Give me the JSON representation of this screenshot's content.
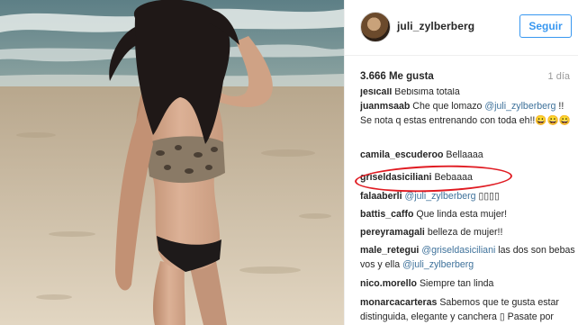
{
  "post": {
    "username": "juli_zylberberg",
    "follow_label": "Seguir",
    "likes": "3.666 Me gusta",
    "time": "1 día"
  },
  "comments": [
    {
      "user": "jesicall",
      "parts": [
        {
          "t": "Bebisima totala",
          "m": false
        }
      ]
    },
    {
      "user": "juanmsaab",
      "parts": [
        {
          "t": "Che que lomazo ",
          "m": false
        },
        {
          "t": "@juli_zylberberg",
          "m": true
        },
        {
          "t": " !! Se nota q estas entrenando con toda eh!!😀😀😀",
          "m": false
        }
      ]
    },
    {
      "user": "camila_escuderoo",
      "parts": [
        {
          "t": "Bellaaaa",
          "m": false
        }
      ]
    },
    {
      "user": "griseldasiciliani",
      "parts": [
        {
          "t": "Bebaaaa",
          "m": false
        }
      ]
    },
    {
      "user": "falaaberli",
      "parts": [
        {
          "t": "@juli_zylberberg",
          "m": true
        },
        {
          "t": " ▯▯▯▯",
          "m": false
        }
      ]
    },
    {
      "user": "battis_caffo",
      "parts": [
        {
          "t": "Que linda esta mujer!",
          "m": false
        }
      ]
    },
    {
      "user": "pereyramagali",
      "parts": [
        {
          "t": "belleza de mujer!!",
          "m": false
        }
      ]
    },
    {
      "user": "male_retegui",
      "parts": [
        {
          "t": "@griseldasiciliani",
          "m": true
        },
        {
          "t": " las dos son bebas vos y ella ",
          "m": false
        },
        {
          "t": "@juli_zylberberg",
          "m": true
        }
      ]
    },
    {
      "user": "nico.morello",
      "parts": [
        {
          "t": "Siempre tan linda",
          "m": false
        }
      ]
    },
    {
      "user": "monarcacarteras",
      "parts": [
        {
          "t": "Sabemos que te gusta estar distinguida, elegante y canchera ▯ Pasate por MONARCA te vas a e",
          "m": false
        }
      ]
    }
  ],
  "colors": {
    "accent": "#3897f0",
    "mention": "#3f729b",
    "highlight_oval": "#e01b22"
  }
}
